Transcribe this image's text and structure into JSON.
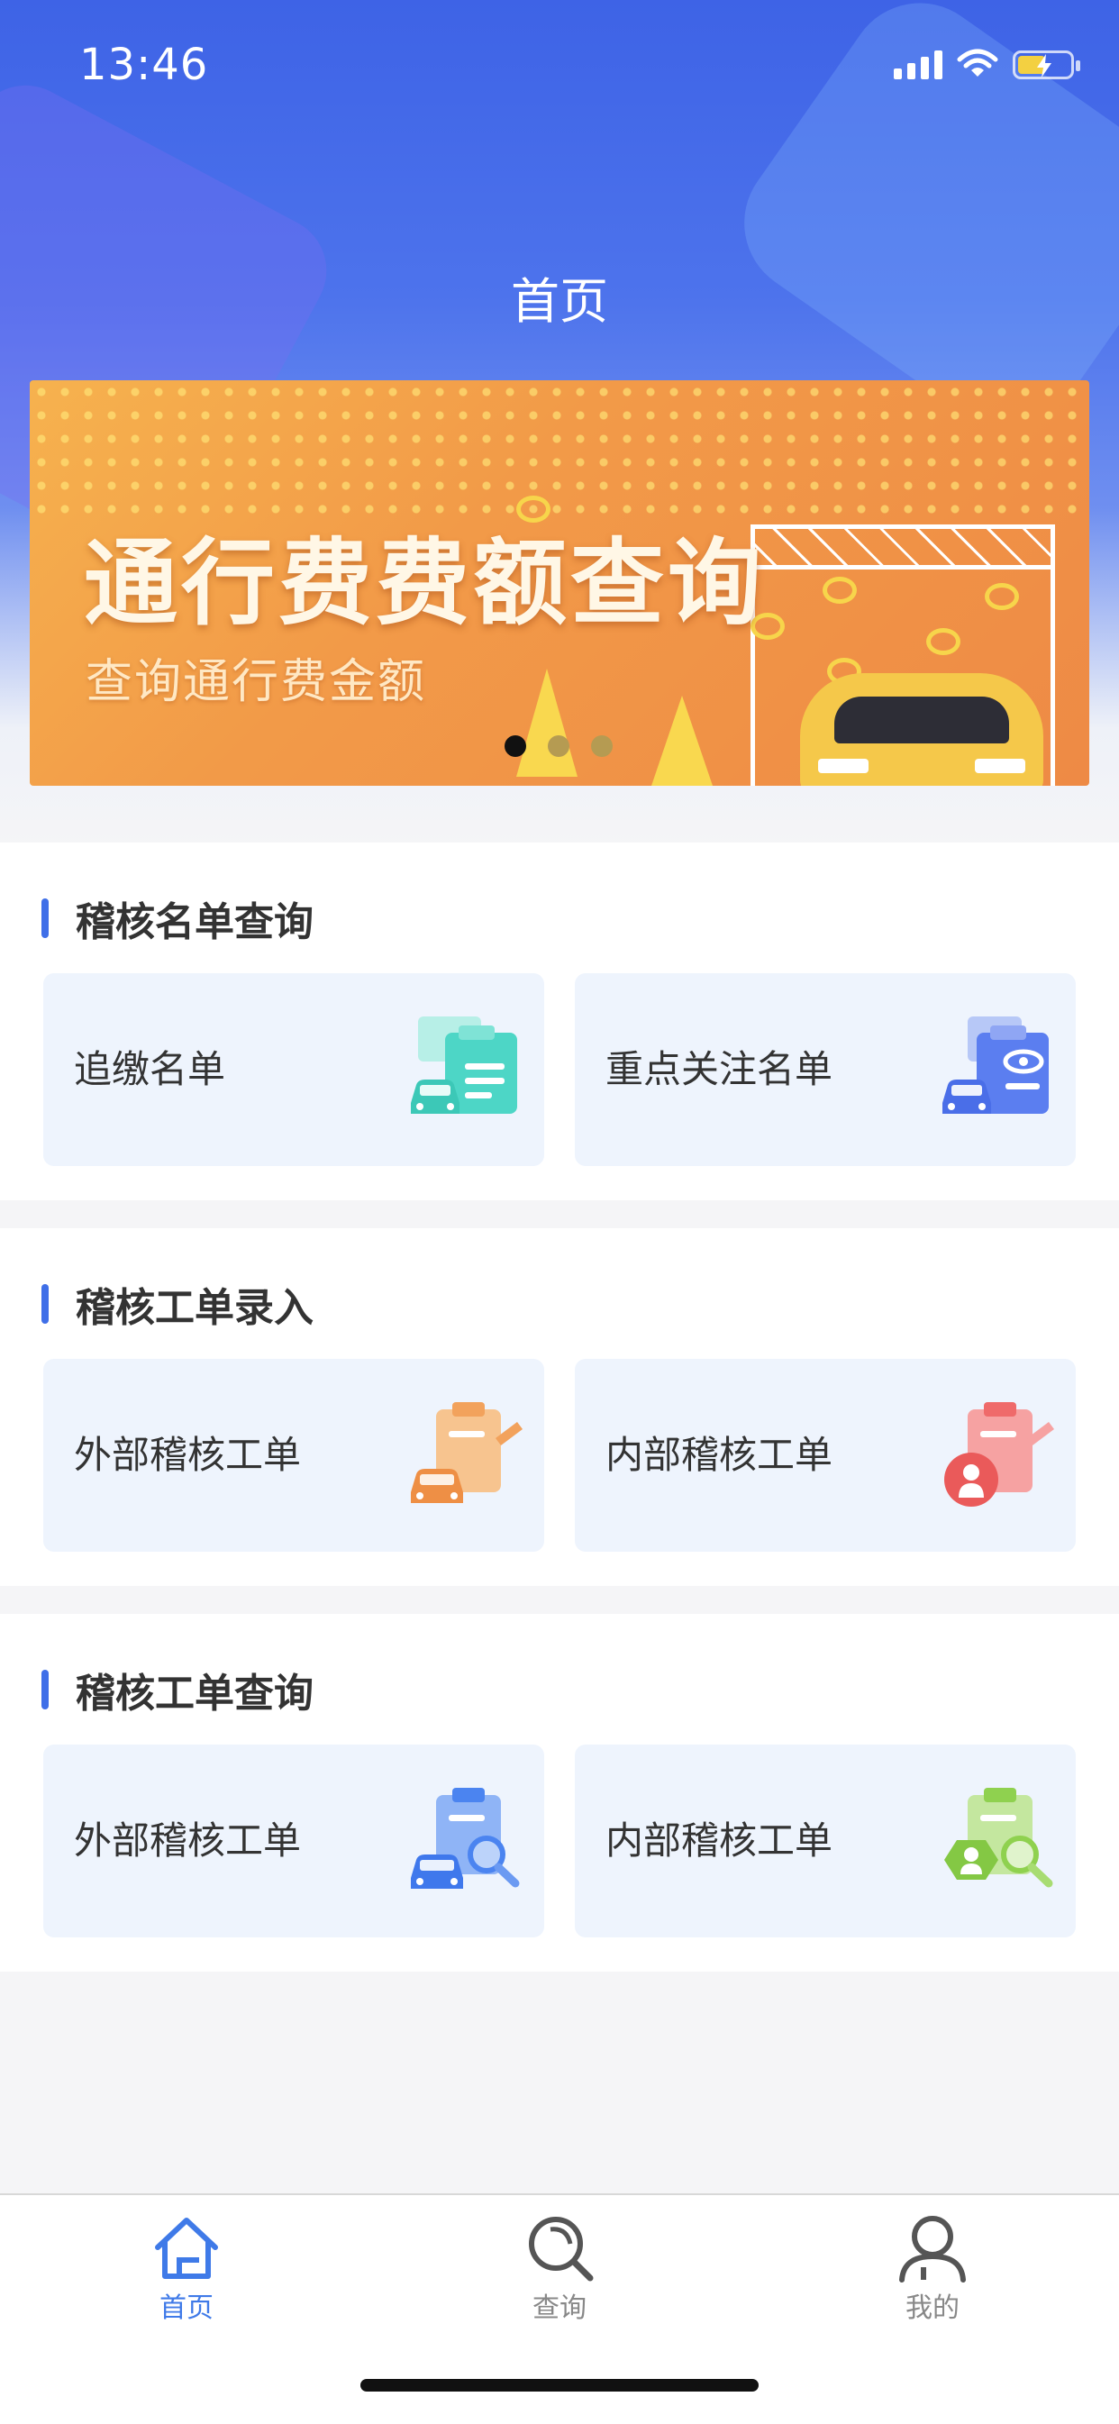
{
  "status_bar": {
    "time": "13:46"
  },
  "header": {
    "title": "首页"
  },
  "banner": {
    "title": "通行费费额查询",
    "subtitle": "查询通行费金额",
    "slide_count": 3,
    "active_slide": 1
  },
  "sections": [
    {
      "title": "稽核名单查询",
      "cards": [
        {
          "label": "追缴名单",
          "icon": "clipboard-car-icon",
          "color": "#4dd6c6"
        },
        {
          "label": "重点关注名单",
          "icon": "clipboard-eye-icon",
          "color": "#5b7ef0"
        }
      ]
    },
    {
      "title": "稽核工单录入",
      "cards": [
        {
          "label": "外部稽核工单",
          "icon": "clipboard-car-edit-icon",
          "color": "#f2a25c"
        },
        {
          "label": "内部稽核工单",
          "icon": "clipboard-person-edit-icon",
          "color": "#ef6a6a"
        }
      ]
    },
    {
      "title": "稽核工单查询",
      "cards": [
        {
          "label": "外部稽核工单",
          "icon": "clipboard-car-search-icon",
          "color": "#4b84f0"
        },
        {
          "label": "内部稽核工单",
          "icon": "clipboard-person-search-icon",
          "color": "#8fd14f"
        }
      ]
    }
  ],
  "tabbar": {
    "items": [
      {
        "label": "首页",
        "icon": "home-icon",
        "active": true
      },
      {
        "label": "查询",
        "icon": "search-icon",
        "active": false
      },
      {
        "label": "我的",
        "icon": "user-icon",
        "active": false
      }
    ],
    "active_color": "#3f7ae8",
    "inactive_color": "#888888"
  }
}
